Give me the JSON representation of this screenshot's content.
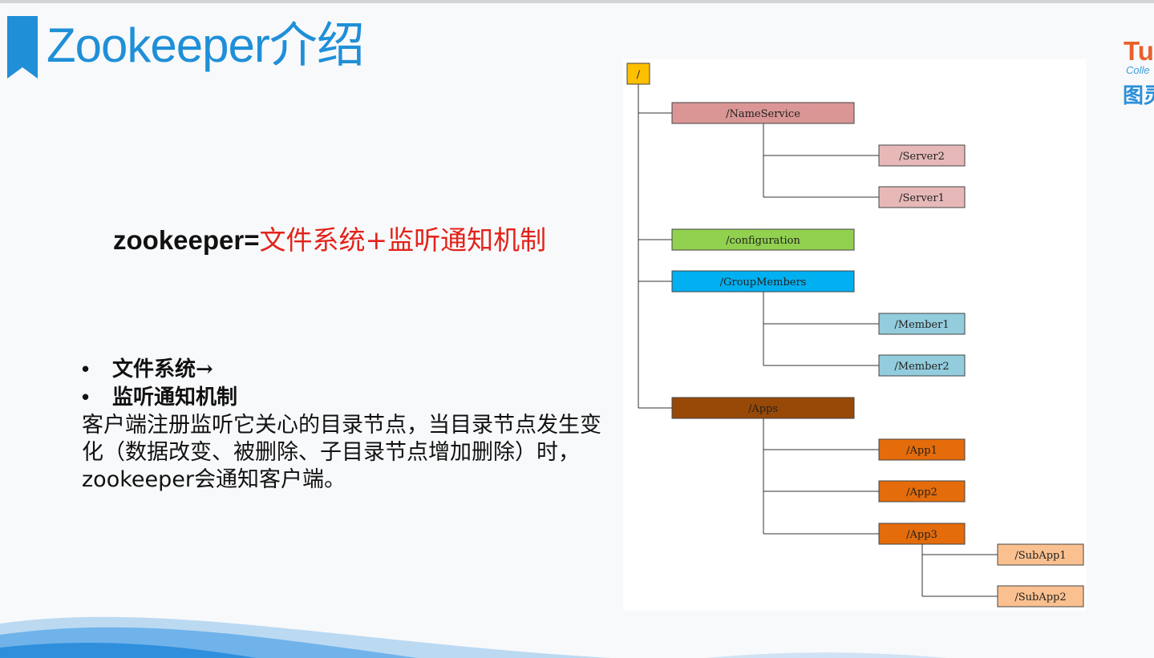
{
  "header": {
    "title": "Zookeeper介绍"
  },
  "formula": {
    "left": "zookeeper=",
    "right": "文件系统+监听通知机制"
  },
  "bullets": [
    {
      "dot": "•",
      "text": "文件系统→"
    },
    {
      "dot": "•",
      "text": "监听通知机制"
    }
  ],
  "description": "客户端注册监听它关心的目录节点，当目录节点发生变化（数据改变、被删除、子目录节点增加删除）时，zookeeper会通知客户端。",
  "logo": {
    "brand": "Tu",
    "sub": "Colle",
    "cn": "图灵"
  },
  "tree": {
    "root": "/",
    "nodes": [
      {
        "label": "/NameService",
        "color": "#d99694"
      },
      {
        "label": "/Server2",
        "color": "#e6b9b8"
      },
      {
        "label": "/Server1",
        "color": "#e6b9b8"
      },
      {
        "label": "/configuration",
        "color": "#92d050"
      },
      {
        "label": "/GroupMembers",
        "color": "#00b0f0"
      },
      {
        "label": "/Member1",
        "color": "#93cddd"
      },
      {
        "label": "/Member2",
        "color": "#93cddd"
      },
      {
        "label": "/Apps",
        "color": "#984807"
      },
      {
        "label": "/App1",
        "color": "#e46c0a"
      },
      {
        "label": "/App2",
        "color": "#e46c0a"
      },
      {
        "label": "/App3",
        "color": "#e46c0a"
      },
      {
        "label": "/SubApp1",
        "color": "#fac090"
      },
      {
        "label": "/SubApp2",
        "color": "#fac090"
      }
    ],
    "root_color": "#ffc000"
  }
}
